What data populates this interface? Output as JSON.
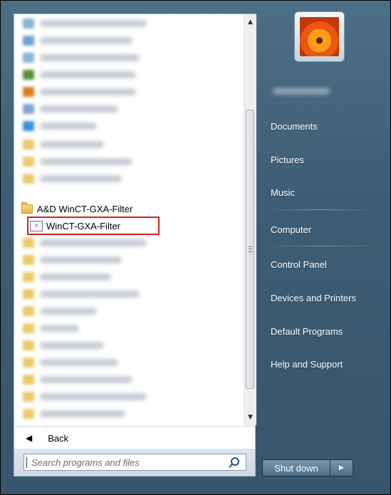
{
  "programs": {
    "folder_label": "A&D WinCT-GXA-Filter",
    "app_label": "WinCT-GXA-Filter",
    "app_icon_glyph": "≠"
  },
  "nav": {
    "back_label": "Back"
  },
  "search": {
    "placeholder": "Search programs and files"
  },
  "right_menu": {
    "items": [
      "Documents",
      "Pictures",
      "Music",
      "Computer",
      "Control Panel",
      "Devices and Printers",
      "Default Programs",
      "Help and Support"
    ]
  },
  "shutdown": {
    "label": "Shut down"
  }
}
